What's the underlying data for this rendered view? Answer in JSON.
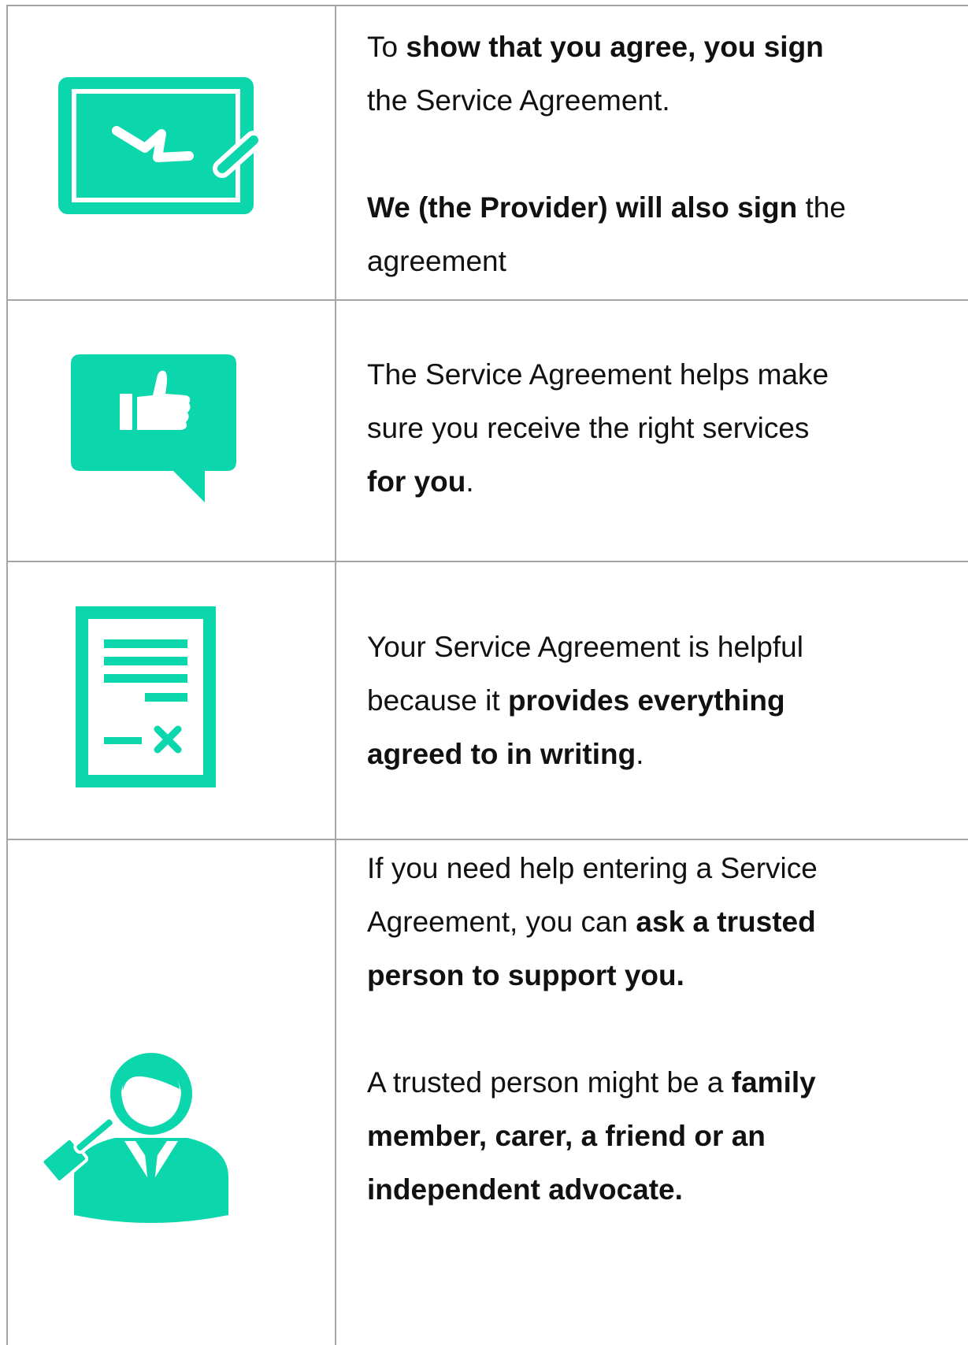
{
  "colors": {
    "accent": "#0bd6ac",
    "border": "#a6a6a6",
    "text": "#111111"
  },
  "rows": [
    {
      "icon": "signature-board-icon",
      "p1": {
        "a": "To ",
        "b": "show that you agree, you sign",
        "c": "",
        "line2": "the Service Agreement."
      },
      "p2": {
        "a": "We (the Provider) will also sign",
        "b": " the",
        "line2": "agreement"
      }
    },
    {
      "icon": "thumbs-up-speech-bubble-icon",
      "line1": "The Service Agreement helps make",
      "line2": "sure you receive the right services",
      "line3_bold": "for you",
      "line3_end": "."
    },
    {
      "icon": "signed-document-icon",
      "line1": "Your Service Agreement is helpful",
      "line2_a": "because it ",
      "line2_b": "provides everything",
      "line3_bold": "agreed to in writing",
      "line3_end": "."
    },
    {
      "icon": "advocate-person-with-gavel-icon",
      "line1": "If you need help entering a Service",
      "line2_a": "Agreement, you can ",
      "line2_b": "ask a trusted",
      "line3_bold": "person to support you.",
      "line4_a": "A trusted person might be a ",
      "line4_b": "family",
      "line5_bold": "member, carer, a friend or an",
      "line6_bold": "independent advocate."
    }
  ]
}
